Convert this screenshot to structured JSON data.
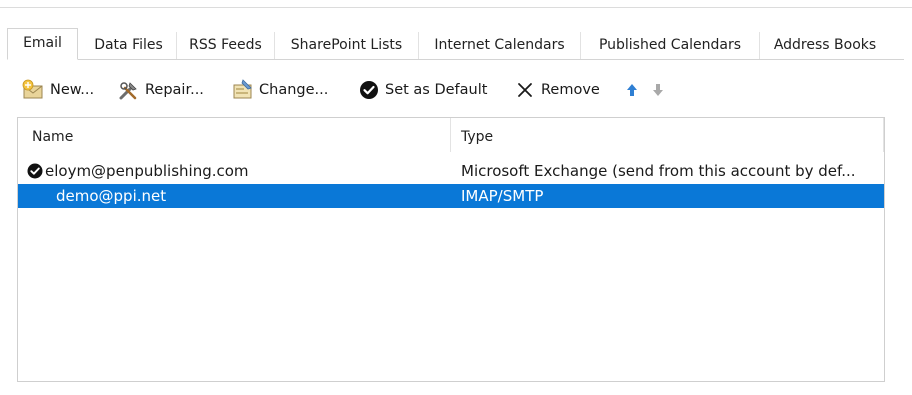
{
  "tabs": [
    {
      "label": "Email",
      "active": true
    },
    {
      "label": "Data Files",
      "active": false
    },
    {
      "label": "RSS Feeds",
      "active": false
    },
    {
      "label": "SharePoint Lists",
      "active": false
    },
    {
      "label": "Internet Calendars",
      "active": false
    },
    {
      "label": "Published Calendars",
      "active": false
    },
    {
      "label": "Address Books",
      "active": false
    }
  ],
  "toolbar": {
    "new_label": "New...",
    "repair_label": "Repair...",
    "change_label": "Change...",
    "set_default_label": "Set as Default",
    "remove_label": "Remove",
    "icons": {
      "new": "new-mail-icon",
      "repair": "repair-tools-icon",
      "change": "change-account-icon",
      "set_default": "checkmark-circle-icon",
      "remove": "x-icon",
      "move_up": "arrow-up-icon",
      "move_down": "arrow-down-icon"
    }
  },
  "accounts_list": {
    "columns": [
      "Name",
      "Type"
    ],
    "rows": [
      {
        "name": "eloym@penpublishing.com",
        "type": "Microsoft Exchange (send from this account by def...",
        "is_default": true,
        "selected": false
      },
      {
        "name": "demo@ppi.net",
        "type": "IMAP/SMTP",
        "is_default": false,
        "selected": true
      }
    ]
  },
  "colors": {
    "selection": "#0a78d7",
    "up_arrow": "#2f7fd3",
    "down_arrow": "#a9a9a9"
  }
}
